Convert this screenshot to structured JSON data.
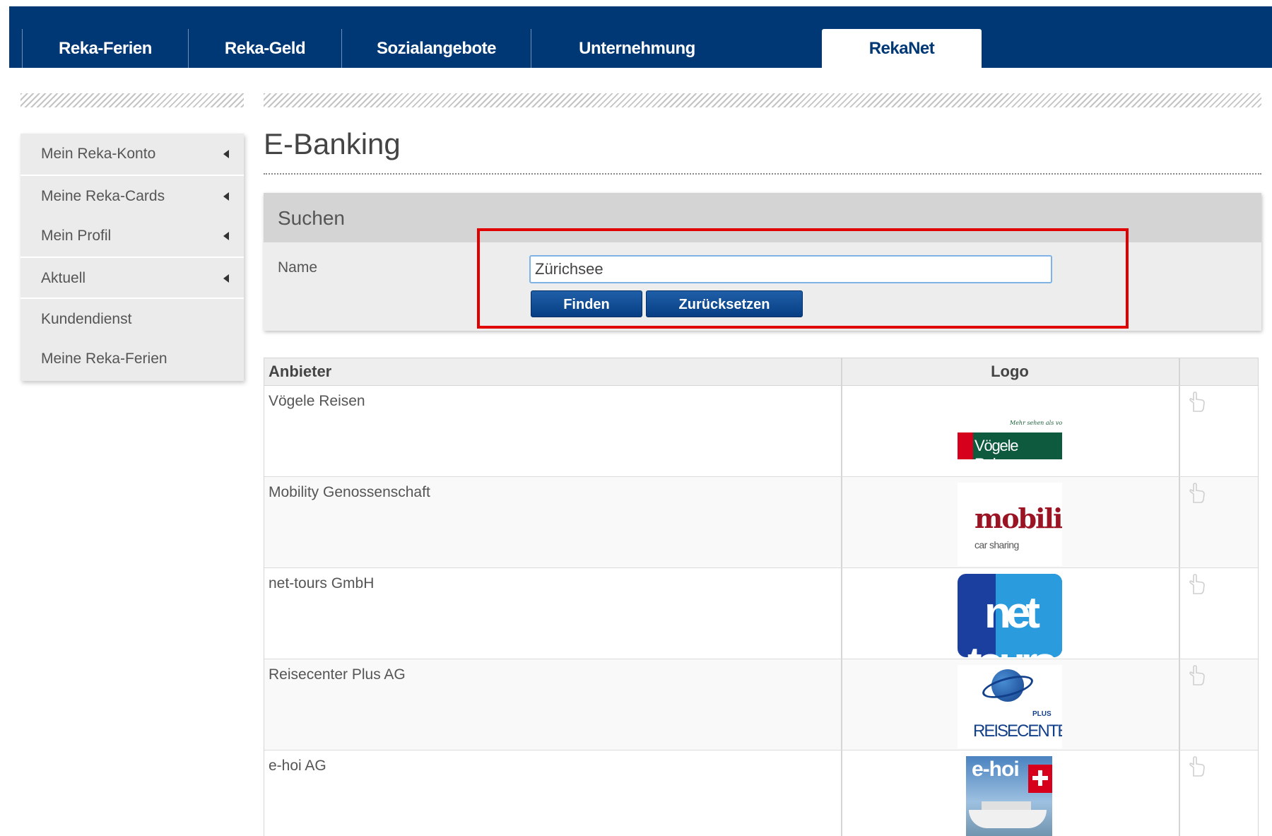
{
  "nav": {
    "items": [
      "Reka-Ferien",
      "Reka-Geld",
      "Sozialangebote",
      "Unternehmung",
      "RekaNet"
    ],
    "active": "RekaNet"
  },
  "sidebar": {
    "items": [
      "Mein Reka-Konto",
      "Meine Reka-Cards",
      "Mein Profil",
      "Aktuell",
      "Kundendienst",
      "Meine Reka-Ferien"
    ]
  },
  "page": {
    "title": "E-Banking"
  },
  "search": {
    "title": "Suchen",
    "name_label": "Name",
    "name_value": "Zürichsee",
    "find_label": "Finden",
    "reset_label": "Zurücksetzen"
  },
  "table": {
    "headers": {
      "provider": "Anbieter",
      "logo": "Logo"
    },
    "rows": [
      {
        "name": "Vögele Reisen"
      },
      {
        "name": "Mobility Genossenschaft"
      },
      {
        "name": "net-tours GmbH"
      },
      {
        "name": "Reisecenter Plus AG"
      },
      {
        "name": "e-hoi AG"
      }
    ]
  },
  "logos": {
    "vogele": {
      "tagline": "Mehr sehen als vorgestellt!",
      "text": "Vögele Reisen"
    },
    "mobility": {
      "main": "mobility",
      "sub": "car sharing"
    },
    "nettours": {
      "text": "net tours"
    },
    "reisecenter": {
      "plus": "PLUS",
      "text": "REISECENTER"
    },
    "ehoi": {
      "text": "e-hoi"
    }
  },
  "colors": {
    "brand_navy": "#003876",
    "button_blue": "#0d4a92",
    "highlight_red": "#e00000"
  },
  "icons": {
    "row_action": "pointing-hand-icon",
    "menu_arrow": "caret-left-icon"
  }
}
